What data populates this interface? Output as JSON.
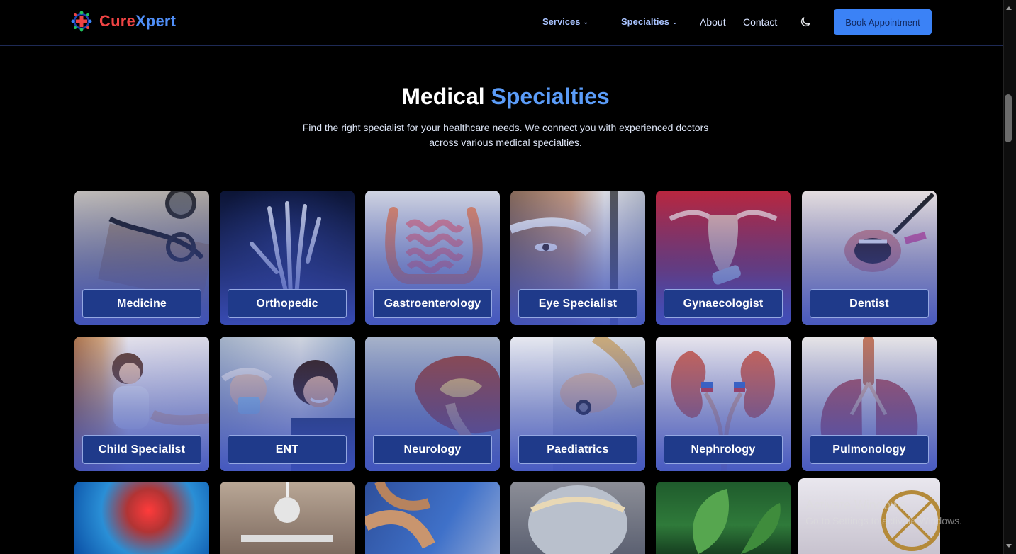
{
  "header": {
    "logo": {
      "part1": "Cure",
      "part2": "Xpert"
    },
    "nav": {
      "services": "Services",
      "specialties": "Specialties",
      "about": "About",
      "contact": "Contact"
    },
    "book_label": "Book Appointment"
  },
  "hero": {
    "title_part1": "Medical",
    "title_part2": "Specialties",
    "subtitle_line1": "Find the right specialist for your healthcare needs. We connect you with experienced doctors",
    "subtitle_line2": "across various medical specialties."
  },
  "specialties": [
    {
      "label": "Medicine",
      "icon": "stethoscope-icon"
    },
    {
      "label": "Orthopedic",
      "icon": "xray-hand-icon"
    },
    {
      "label": "Gastroenterology",
      "icon": "intestines-icon"
    },
    {
      "label": "Eye Specialist",
      "icon": "eye-exam-icon"
    },
    {
      "label": "Gynaecologist",
      "icon": "uterus-icon"
    },
    {
      "label": "Dentist",
      "icon": "tooth-icon"
    },
    {
      "label": "Child Specialist",
      "icon": "child-icon"
    },
    {
      "label": "ENT",
      "icon": "ent-icon"
    },
    {
      "label": "Neurology",
      "icon": "brain-icon"
    },
    {
      "label": "Paediatrics",
      "icon": "paediatrics-icon"
    },
    {
      "label": "Nephrology",
      "icon": "kidney-icon"
    },
    {
      "label": "Pulmonology",
      "icon": "lungs-icon"
    }
  ],
  "watermark": {
    "line1": "Activate Windows",
    "line2": "Go to Settings to activate Windows."
  },
  "colors": {
    "accent": "#3b82f6",
    "title_highlight": "#5b9cf8",
    "label_bg": "#1f3a8a",
    "logo_red": "#ef4444",
    "logo_blue": "#4f8ef7"
  }
}
